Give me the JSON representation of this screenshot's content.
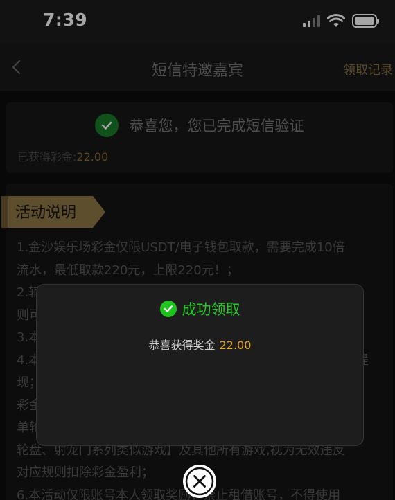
{
  "status_bar": {
    "time": "7:39"
  },
  "nav": {
    "title": "短信特邀嘉宾",
    "action": "领取记录"
  },
  "verify": {
    "message": "恭喜您，您已完成短信验证",
    "earned_label": "已获得彩金:",
    "earned_amount": "22.00"
  },
  "rules": {
    "tag": "活动说明",
    "lines": [
      "1.金沙娱乐场彩金仅限USDT/电子钱包取款，需要完成10倍",
      "流水，最低取款220元，上限220元！；",
      "2.辅",
      "则可",
      "3.本",
      "4.本",
      "现；",
      "彩金",
      "单轮",
      "轮盘、射龙门系列类似游戏】及其他所有游戏,视为无效违反",
      "对应规则扣除彩金盈利；",
      "6.本活动仅限账号本人领取奖励，禁止租借账号，不得使用"
    ],
    "line4_tail": "提"
  },
  "modal": {
    "title": "成功领取",
    "message": "恭喜获得奖金",
    "amount": "22.00"
  },
  "colors": {
    "accent_gold": "#e8a623",
    "success_green": "#26c726",
    "tag_gold": "#9c8450"
  },
  "icons": {
    "back": "chevron-left-icon",
    "check": "check-circle-icon",
    "close": "close-icon"
  }
}
